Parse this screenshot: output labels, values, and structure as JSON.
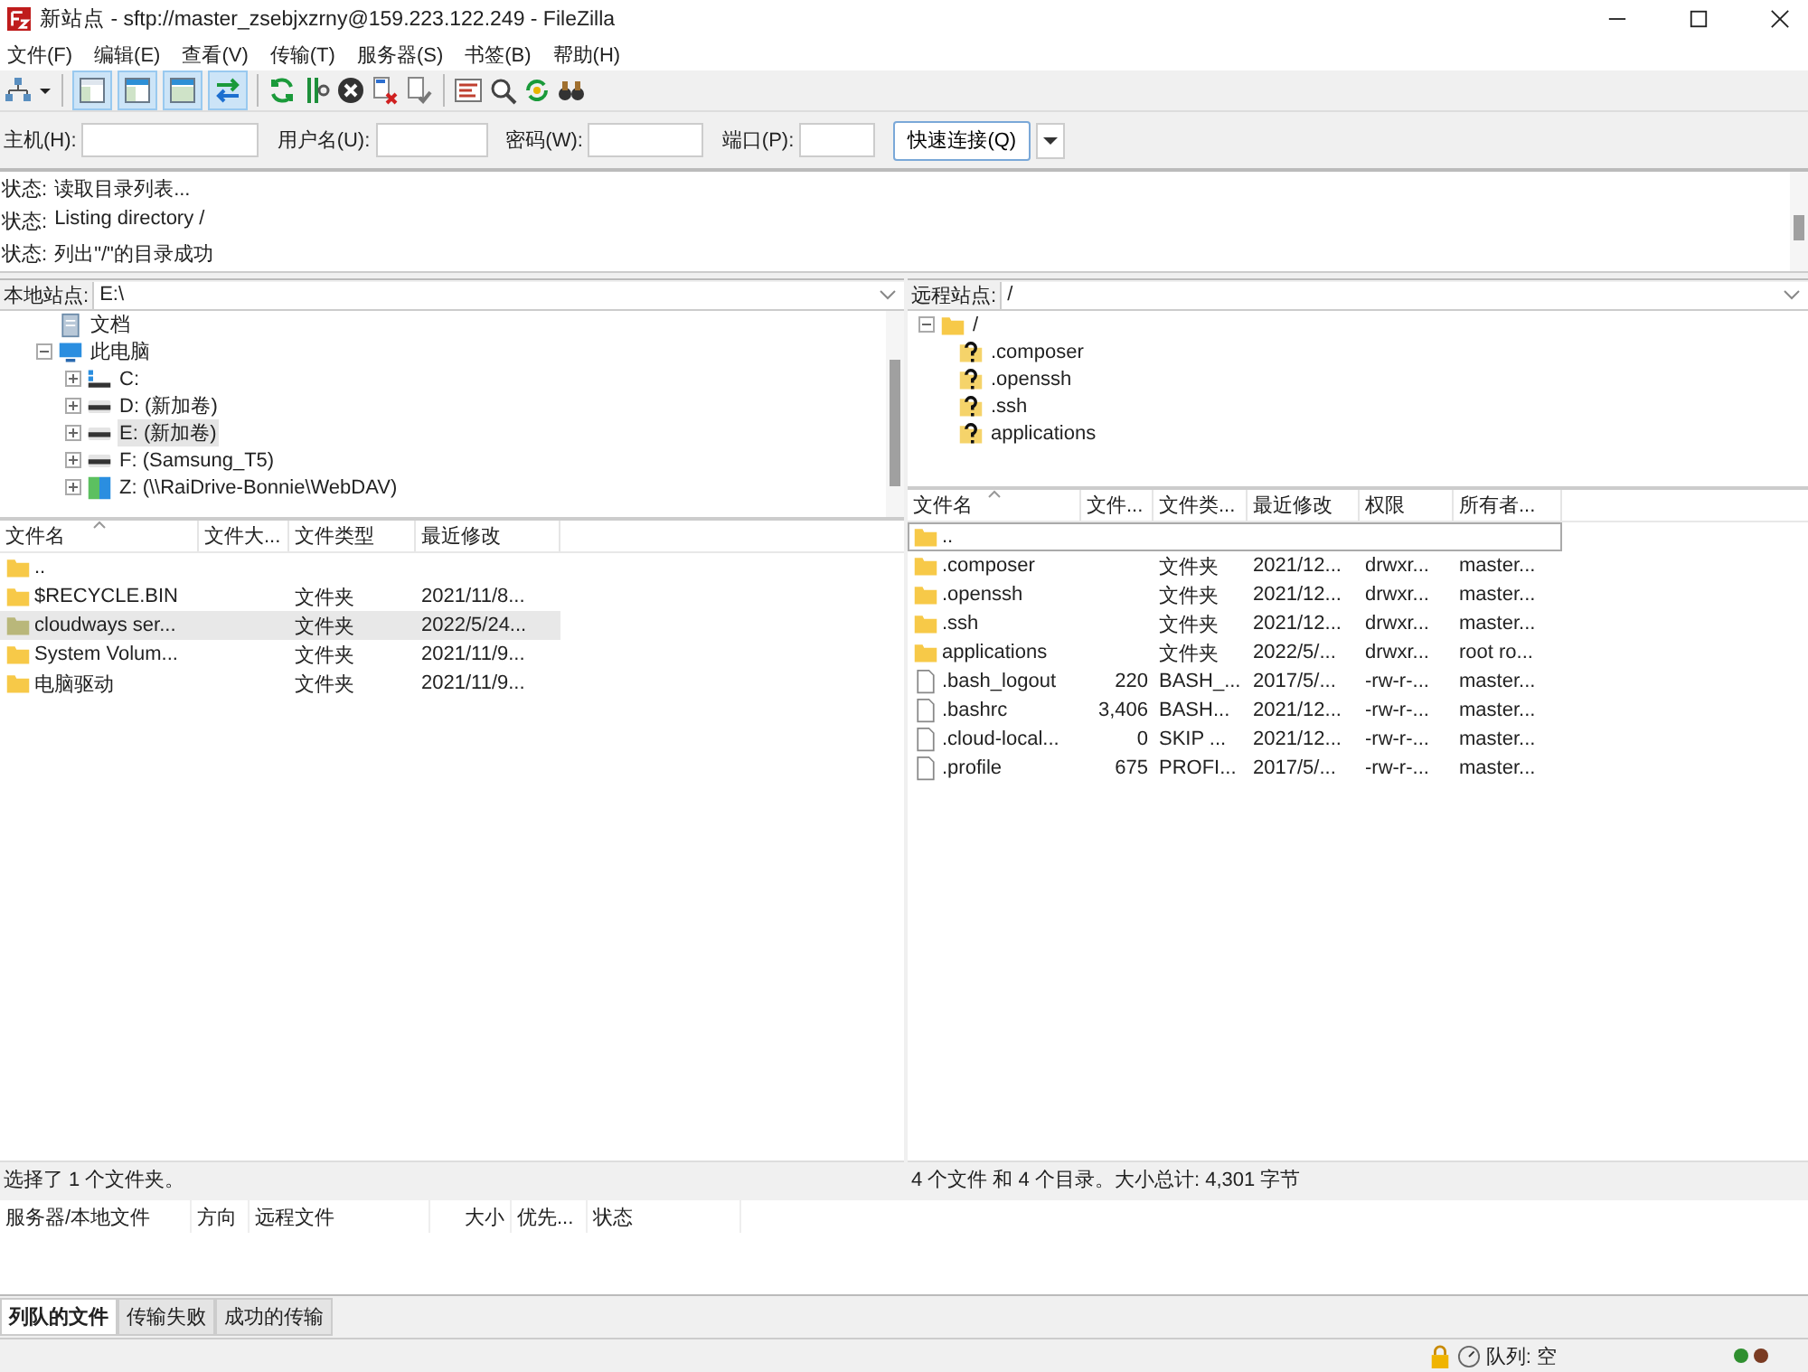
{
  "window": {
    "title": "新站点 - sftp://master_zsebjxzrny@159.223.122.249 - FileZilla"
  },
  "menu": [
    "文件(F)",
    "编辑(E)",
    "查看(V)",
    "传输(T)",
    "服务器(S)",
    "书签(B)",
    "帮助(H)"
  ],
  "toolbar": {
    "toggles": [
      {
        "on": true
      },
      {
        "on": true
      },
      {
        "on": true
      },
      {
        "on": true
      }
    ]
  },
  "quickconnect": {
    "fields": [
      {
        "label": "主机(H):"
      },
      {
        "label": "用户名(U):"
      },
      {
        "label": "密码(W):"
      },
      {
        "label": "端口(P):"
      }
    ],
    "button": "快速连接(Q)"
  },
  "log": [
    {
      "label": "状态:",
      "text": "读取目录列表..."
    },
    {
      "label": "状态:",
      "text": "Listing directory /"
    },
    {
      "label": "状态:",
      "text": "列出\"/\"的目录成功"
    }
  ],
  "local": {
    "label": "本地站点:",
    "path": "E:\\",
    "tree": [
      {
        "kind": "document",
        "name": "文档",
        "selected": false
      },
      {
        "kind": "computer",
        "name": "此电脑",
        "selected": false,
        "expanded": true,
        "children": [
          {
            "kind": "system-drive",
            "name": "C:",
            "selected": false,
            "expanded": false
          },
          {
            "kind": "drive",
            "name": "D: (新加卷)",
            "selected": false,
            "expanded": false
          },
          {
            "kind": "drive",
            "name": "E: (新加卷)",
            "selected": true,
            "expanded": false
          },
          {
            "kind": "drive",
            "name": "F: (Samsung_T5)",
            "selected": false,
            "expanded": false
          },
          {
            "kind": "network",
            "name": "Z: (\\\\RaiDrive-Bonnie\\WebDAV)",
            "selected": false,
            "expanded": false
          }
        ]
      }
    ],
    "columns": [
      {
        "label": "文件名",
        "sorted": true
      },
      {
        "label": "文件大...",
        "sorted": false
      },
      {
        "label": "文件类型",
        "sorted": false
      },
      {
        "label": "最近修改",
        "sorted": false
      }
    ],
    "rows": [
      {
        "kind": "folder",
        "name": "..",
        "selected": false
      },
      {
        "kind": "folder",
        "name": "$RECYCLE.BIN",
        "type": "文件夹",
        "modified": "2021/11/8...",
        "selected": false
      },
      {
        "kind": "special-folder",
        "name": "cloudways ser...",
        "type": "文件夹",
        "modified": "2022/5/24...",
        "selected": true
      },
      {
        "kind": "folder",
        "name": "System Volum...",
        "type": "文件夹",
        "modified": "2021/11/9...",
        "selected": false
      },
      {
        "kind": "folder",
        "name": "电脑驱动",
        "type": "文件夹",
        "modified": "2021/11/9...",
        "selected": false
      }
    ],
    "status": "选择了 1 个文件夹。"
  },
  "remote": {
    "label": "远程站点:",
    "path": "/",
    "tree": [
      {
        "kind": "folder",
        "name": "/",
        "selected": false,
        "expanded": true,
        "children": [
          {
            "kind": "unknown",
            "name": ".composer",
            "selected": false
          },
          {
            "kind": "unknown",
            "name": ".openssh",
            "selected": false
          },
          {
            "kind": "unknown",
            "name": ".ssh",
            "selected": false
          },
          {
            "kind": "unknown",
            "name": "applications",
            "selected": false
          }
        ]
      }
    ],
    "columns": [
      {
        "label": "文件名",
        "sorted": true
      },
      {
        "label": "文件...",
        "sorted": false
      },
      {
        "label": "文件类...",
        "sorted": false
      },
      {
        "label": "最近修改",
        "sorted": false
      },
      {
        "label": "权限",
        "sorted": false
      },
      {
        "label": "所有者...",
        "sorted": false
      }
    ],
    "rows": [
      {
        "kind": "folder",
        "name": "..",
        "focused": true
      },
      {
        "kind": "folder",
        "name": ".composer",
        "type": "文件夹",
        "modified": "2021/12...",
        "permissions": "drwxr...",
        "owner": "master...",
        "focused": false
      },
      {
        "kind": "folder",
        "name": ".openssh",
        "type": "文件夹",
        "modified": "2021/12...",
        "permissions": "drwxr...",
        "owner": "master...",
        "focused": false
      },
      {
        "kind": "folder",
        "name": ".ssh",
        "type": "文件夹",
        "modified": "2021/12...",
        "permissions": "drwxr...",
        "owner": "master...",
        "focused": false
      },
      {
        "kind": "folder",
        "name": "applications",
        "type": "文件夹",
        "modified": "2022/5/...",
        "permissions": "drwxr...",
        "owner": "root ro...",
        "focused": false
      },
      {
        "kind": "file",
        "name": ".bash_logout",
        "size": "220",
        "type": "BASH_...",
        "modified": "2017/5/...",
        "permissions": "-rw-r-...",
        "owner": "master...",
        "focused": false
      },
      {
        "kind": "file",
        "name": ".bashrc",
        "size": "3,406",
        "type": "BASH...",
        "modified": "2021/12...",
        "permissions": "-rw-r-...",
        "owner": "master...",
        "focused": false
      },
      {
        "kind": "file",
        "name": ".cloud-local...",
        "size": "0",
        "type": "SKIP ...",
        "modified": "2021/12...",
        "permissions": "-rw-r-...",
        "owner": "master...",
        "focused": false
      },
      {
        "kind": "file",
        "name": ".profile",
        "size": "675",
        "type": "PROFI...",
        "modified": "2017/5/...",
        "permissions": "-rw-r-...",
        "owner": "master...",
        "focused": false
      }
    ],
    "status": "4 个文件 和 4 个目录。大小总计: 4,301 字节"
  },
  "queue": {
    "columns": [
      "服务器/本地文件",
      "方向",
      "远程文件",
      "大小",
      "优先...",
      "状态"
    ],
    "tabs": [
      {
        "label": "列队的文件",
        "selected": true
      },
      {
        "label": "传输失败",
        "selected": false
      },
      {
        "label": "成功的传输",
        "selected": false
      }
    ]
  },
  "status_bar": {
    "queue": "队列: 空",
    "lights": [
      {
        "color": "#2f8f2f"
      },
      {
        "color": "#7a3b22"
      }
    ]
  }
}
